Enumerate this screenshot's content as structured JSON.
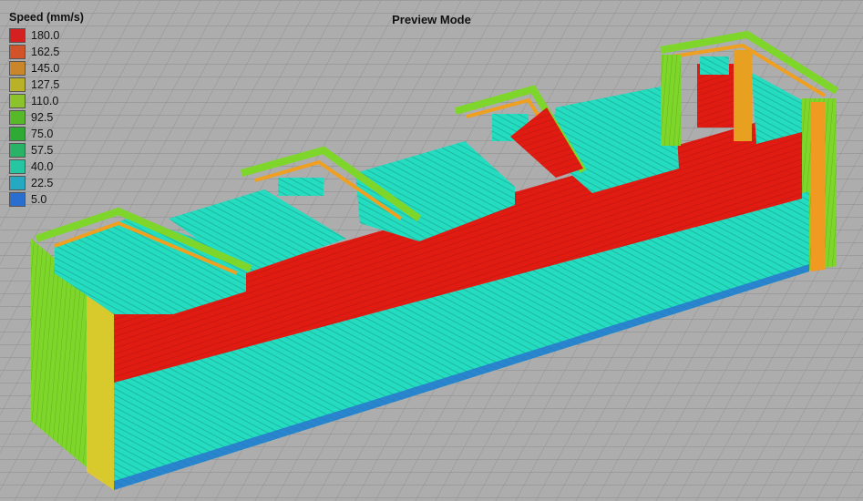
{
  "viewport": {
    "title": "Preview Mode"
  },
  "legend": {
    "title": "Speed (mm/s)",
    "items": [
      {
        "label": "180.0",
        "color": "#d42020"
      },
      {
        "label": "162.5",
        "color": "#d2522a"
      },
      {
        "label": "145.0",
        "color": "#c9862a"
      },
      {
        "label": "127.5",
        "color": "#b9b128"
      },
      {
        "label": "110.0",
        "color": "#8cc22a"
      },
      {
        "label": "92.5",
        "color": "#57b92a"
      },
      {
        "label": "75.0",
        "color": "#2faa34"
      },
      {
        "label": "57.5",
        "color": "#28b366"
      },
      {
        "label": "40.0",
        "color": "#27c6a2"
      },
      {
        "label": "22.5",
        "color": "#25a8c2"
      },
      {
        "label": "5.0",
        "color": "#2a6fcf"
      }
    ]
  },
  "model_colors": {
    "grid_bg": "#adadad",
    "grid_line": "#8f8f8f",
    "infill": "#24dcc0",
    "perimeter": "#e01b12",
    "outer_wall": "#7ed62a",
    "orange_band": "#f0a020",
    "yellow_band": "#dfe03a",
    "shadow": "#1a8a78"
  }
}
